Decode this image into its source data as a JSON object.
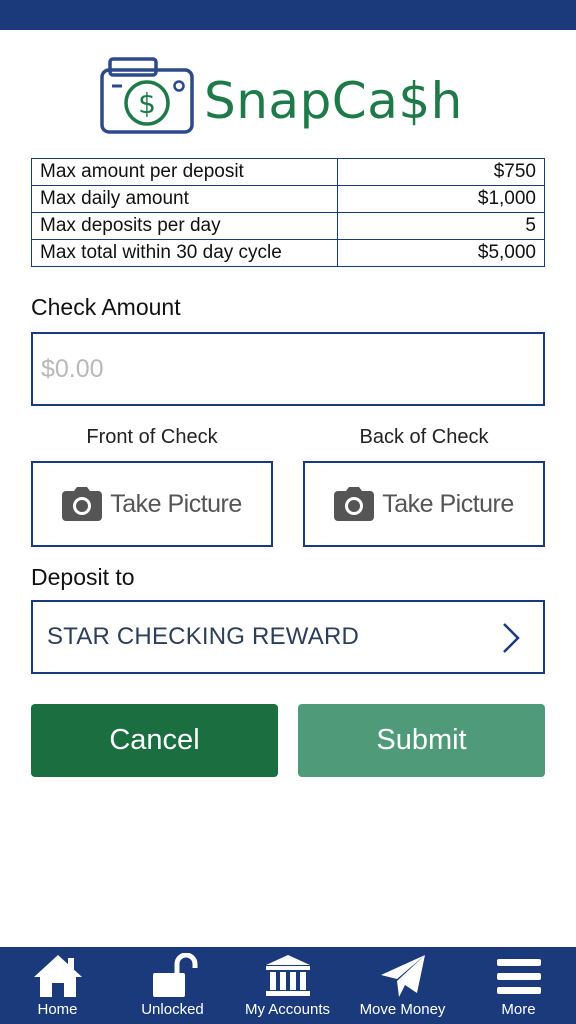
{
  "colors": {
    "brand_navy": "#1a3a7c",
    "brand_green": "#1f7a4a",
    "cancel_green": "#1b6e40",
    "submit_green": "#4f9a79"
  },
  "logo": {
    "text": "SnapCa$h"
  },
  "limits": [
    {
      "label": "Max amount per deposit",
      "value": "$750"
    },
    {
      "label": "Max daily amount",
      "value": "$1,000"
    },
    {
      "label": "Max deposits per day",
      "value": "5"
    },
    {
      "label": "Max total within 30 day cycle",
      "value": "$5,000"
    }
  ],
  "check_amount": {
    "label": "Check Amount",
    "placeholder": "$0.00",
    "value": ""
  },
  "front": {
    "label": "Front of Check",
    "button": "Take Picture",
    "icon": "camera-icon"
  },
  "back": {
    "label": "Back of Check",
    "button": "Take Picture",
    "icon": "camera-icon"
  },
  "deposit": {
    "label": "Deposit to",
    "account": "STAR CHECKING REWARD",
    "icon": "chevron-right-icon"
  },
  "buttons": {
    "cancel": "Cancel",
    "submit": "Submit"
  },
  "tabs": [
    {
      "label": "Home",
      "icon": "home-icon"
    },
    {
      "label": "Unlocked",
      "icon": "unlock-icon"
    },
    {
      "label": "My Accounts",
      "icon": "bank-icon"
    },
    {
      "label": "Move Money",
      "icon": "paper-plane-icon"
    },
    {
      "label": "More",
      "icon": "menu-icon"
    }
  ]
}
